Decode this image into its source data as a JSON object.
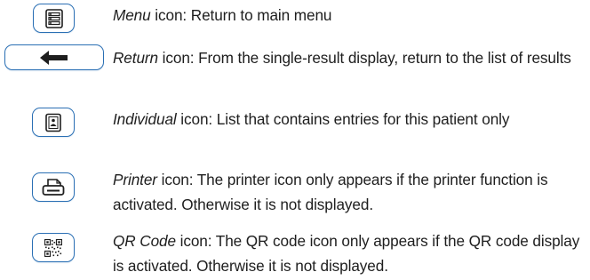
{
  "colors": {
    "icon_border": "#2a6fb4",
    "icon_glyph": "#1e1e1e",
    "text": "#1e1e1e"
  },
  "icons": [
    {
      "icon": "menu-icon",
      "term": "Menu",
      "rest": " icon: Return to main menu"
    },
    {
      "icon": "return-arrow-icon",
      "term": "Return",
      "rest": " icon: From the single-result display, return to the list of results"
    },
    {
      "icon": "individual-icon",
      "term": "Individual",
      "rest": " icon: List that contains entries for this patient only"
    },
    {
      "icon": "printer-icon",
      "term": "Printer",
      "rest": " icon: The printer icon only appears if the printer function is activated. Otherwise it is not displayed."
    },
    {
      "icon": "qr-code-icon",
      "term": "QR Code",
      "rest": " icon: The QR code icon only appears if the QR code display is activated. Otherwise it is not displayed."
    }
  ]
}
